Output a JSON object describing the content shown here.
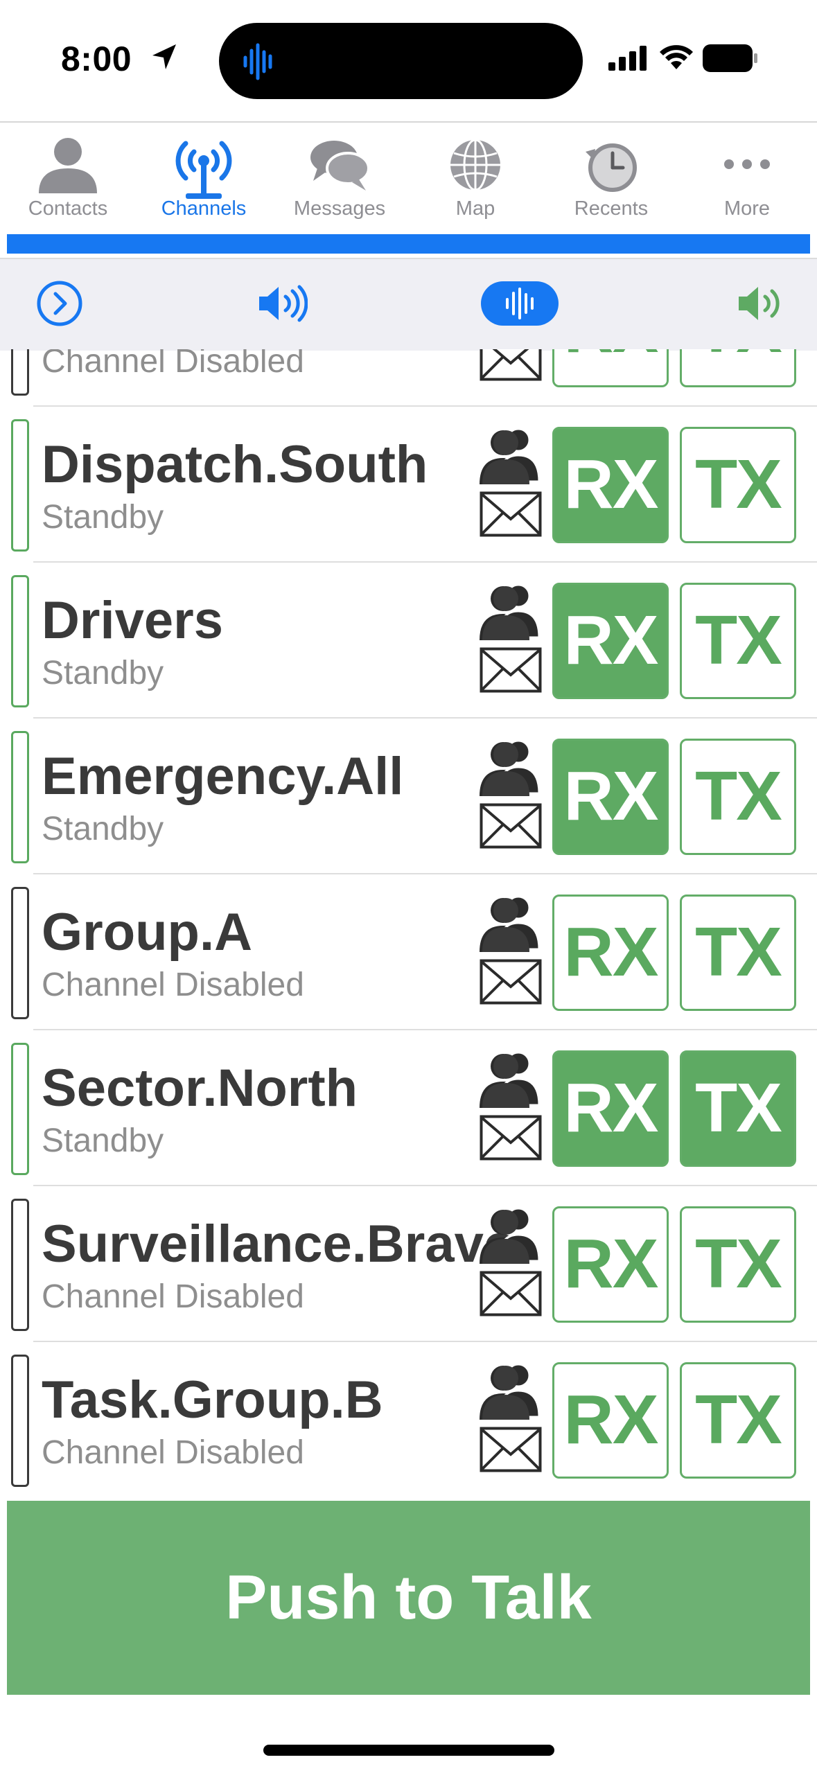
{
  "status_bar": {
    "time": "8:00"
  },
  "tabs": [
    {
      "label": "Contacts",
      "icon": "person-icon",
      "active": false
    },
    {
      "label": "Channels",
      "icon": "antenna-icon",
      "active": true
    },
    {
      "label": "Messages",
      "icon": "chat-bubbles-icon",
      "active": false
    },
    {
      "label": "Map",
      "icon": "globe-icon",
      "active": false
    },
    {
      "label": "Recents",
      "icon": "history-clock-icon",
      "active": false
    },
    {
      "label": "More",
      "icon": "ellipsis-icon",
      "active": false
    }
  ],
  "toolbar": {
    "icons": [
      "chevron-circle-icon",
      "speaker-volume-icon",
      "voice-waveform-icon",
      "speaker-icon"
    ]
  },
  "colors": {
    "accent": "#1778f2",
    "green": "#5eaa63",
    "ptt": "#6db173"
  },
  "channels": [
    {
      "name": "",
      "status": "Channel Disabled",
      "rx_on": false,
      "tx_on": false,
      "rx_label": "RX",
      "tx_label": "TX"
    },
    {
      "name": "Dispatch.South",
      "status": "Standby",
      "rx_on": true,
      "tx_on": false,
      "rx_label": "RX",
      "tx_label": "TX"
    },
    {
      "name": "Drivers",
      "status": "Standby",
      "rx_on": true,
      "tx_on": false,
      "rx_label": "RX",
      "tx_label": "TX"
    },
    {
      "name": "Emergency.All",
      "status": "Standby",
      "rx_on": true,
      "tx_on": false,
      "rx_label": "RX",
      "tx_label": "TX"
    },
    {
      "name": "Group.A",
      "status": "Channel Disabled",
      "rx_on": false,
      "tx_on": false,
      "rx_label": "RX",
      "tx_label": "TX"
    },
    {
      "name": "Sector.North",
      "status": "Standby",
      "rx_on": true,
      "tx_on": true,
      "rx_label": "RX",
      "tx_label": "TX"
    },
    {
      "name": "Surveillance.Bravo",
      "status": "Channel Disabled",
      "rx_on": false,
      "tx_on": false,
      "rx_label": "RX",
      "tx_label": "TX"
    },
    {
      "name": "Task.Group.B",
      "status": "Channel Disabled",
      "rx_on": false,
      "tx_on": false,
      "rx_label": "RX",
      "tx_label": "TX"
    }
  ],
  "ptt": {
    "label": "Push to Talk"
  }
}
